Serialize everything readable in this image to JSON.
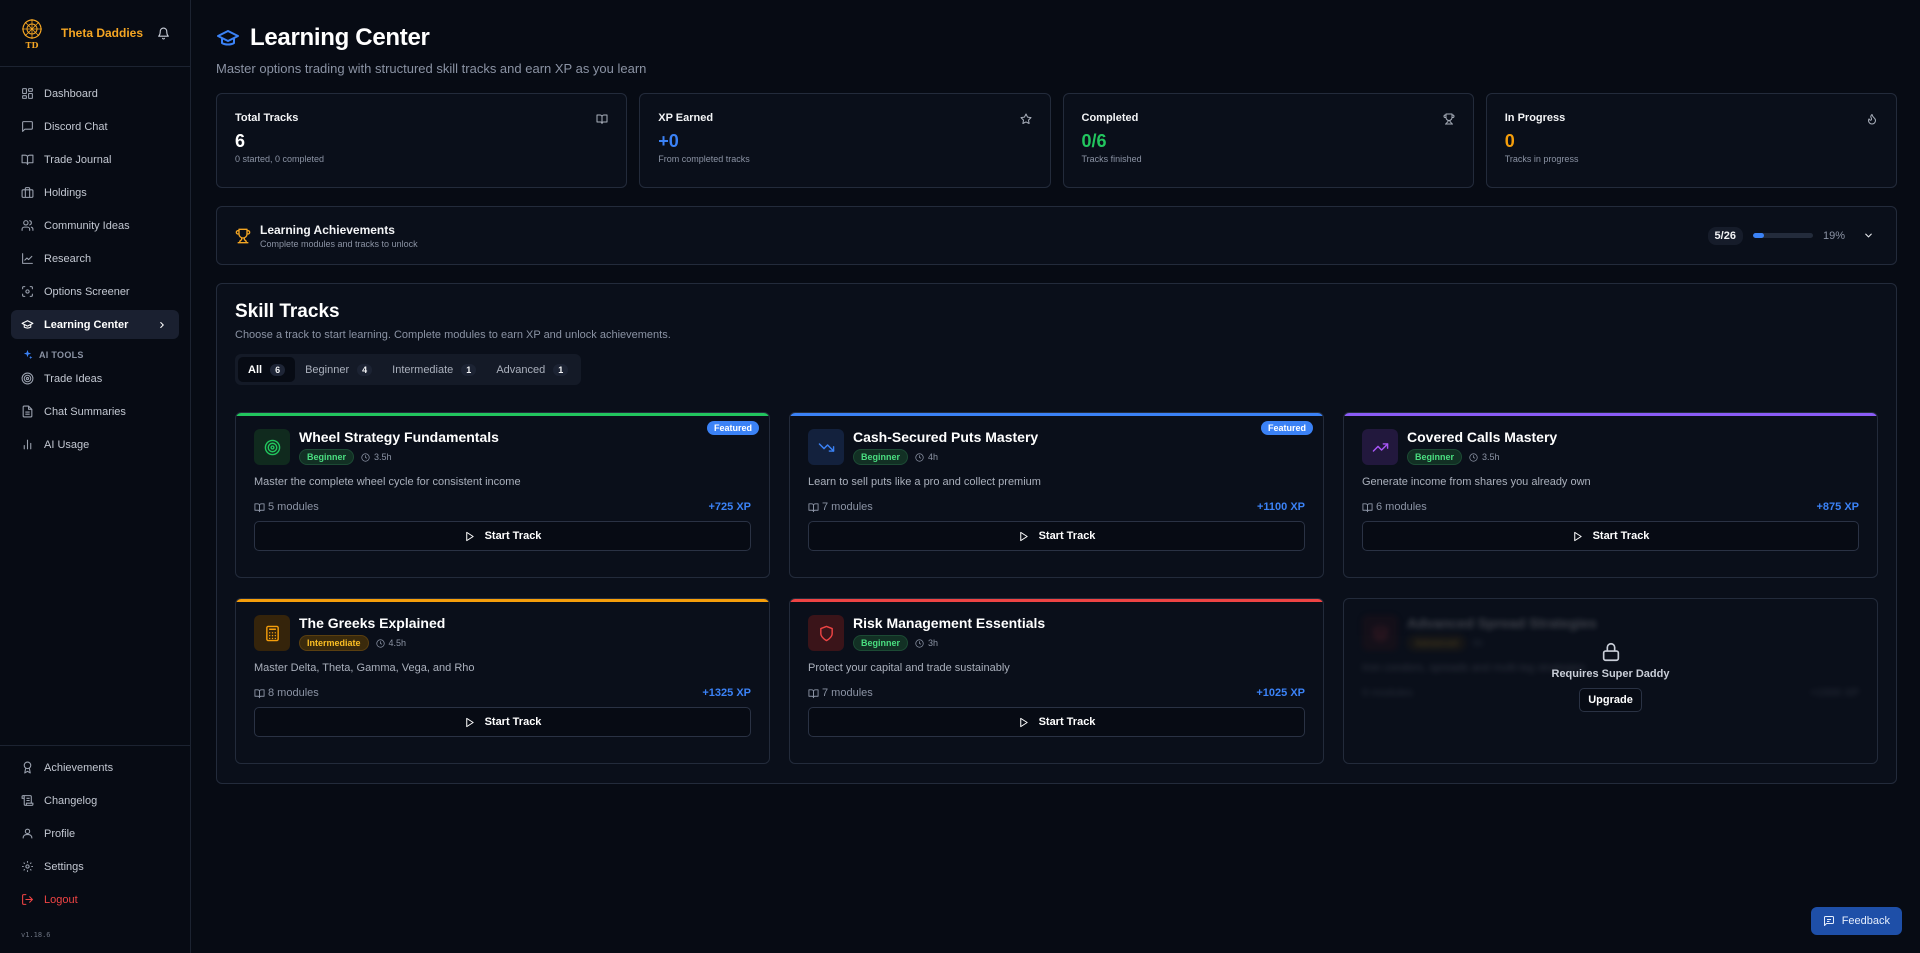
{
  "brand": {
    "name": "Theta Daddies",
    "logo_text": "TD"
  },
  "nav": {
    "items": [
      {
        "label": "Dashboard",
        "icon": "dashboard-icon"
      },
      {
        "label": "Discord Chat",
        "icon": "chat-icon"
      },
      {
        "label": "Trade Journal",
        "icon": "book-icon"
      },
      {
        "label": "Holdings",
        "icon": "briefcase-icon"
      },
      {
        "label": "Community Ideas",
        "icon": "users-icon"
      },
      {
        "label": "Research",
        "icon": "chart-line-icon"
      },
      {
        "label": "Options Screener",
        "icon": "scan-icon"
      },
      {
        "label": "Learning Center",
        "icon": "graduation-cap-icon",
        "active": true
      }
    ],
    "ai_tools_label": "AI TOOLS",
    "ai_items": [
      {
        "label": "Trade Ideas",
        "icon": "target-icon"
      },
      {
        "label": "Chat Summaries",
        "icon": "document-icon"
      },
      {
        "label": "AI Usage",
        "icon": "bar-chart-icon"
      }
    ],
    "bottom_items": [
      {
        "label": "Achievements",
        "icon": "award-icon"
      },
      {
        "label": "Changelog",
        "icon": "scroll-icon"
      },
      {
        "label": "Profile",
        "icon": "user-icon"
      },
      {
        "label": "Settings",
        "icon": "gear-icon"
      },
      {
        "label": "Logout",
        "icon": "logout-icon"
      }
    ],
    "version": "v1.18.6"
  },
  "header": {
    "title": "Learning Center",
    "subtitle": "Master options trading with structured skill tracks and earn XP as you learn"
  },
  "stats": [
    {
      "label": "Total Tracks",
      "value": "6",
      "sub": "0 started, 0 completed",
      "icon": "book-open-icon",
      "color": "#ffffff"
    },
    {
      "label": "XP Earned",
      "value": "+0",
      "sub": "From completed tracks",
      "icon": "star-icon",
      "color": "#3b82f6"
    },
    {
      "label": "Completed",
      "value": "0/6",
      "sub": "Tracks finished",
      "icon": "trophy-icon",
      "color": "#22c55e"
    },
    {
      "label": "In Progress",
      "value": "0",
      "sub": "Tracks in progress",
      "icon": "flame-icon",
      "color": "#f59e0b"
    }
  ],
  "achievements": {
    "title": "Learning Achievements",
    "desc": "Complete modules and tracks to unlock",
    "count": "5/26",
    "percent_label": "19%",
    "progress": 0.19
  },
  "skill_tracks": {
    "title": "Skill Tracks",
    "desc": "Choose a track to start learning. Complete modules to earn XP and unlock achievements.",
    "filters": [
      {
        "label": "All",
        "count": "6",
        "active": true
      },
      {
        "label": "Beginner",
        "count": "4"
      },
      {
        "label": "Intermediate",
        "count": "1"
      },
      {
        "label": "Advanced",
        "count": "1"
      }
    ],
    "start_label": "Start Track",
    "cards": [
      {
        "name": "Wheel Strategy Fundamentals",
        "level": "Beginner",
        "duration": "3.5h",
        "summary": "Master the complete wheel cycle for consistent income",
        "modules": "5 modules",
        "xp": "+725 XP",
        "featured": "Featured",
        "accent": "#22c55e",
        "icon": "target-icon"
      },
      {
        "name": "Cash-Secured Puts Mastery",
        "level": "Beginner",
        "duration": "4h",
        "summary": "Learn to sell puts like a pro and collect premium",
        "modules": "7 modules",
        "xp": "+1100 XP",
        "featured": "Featured",
        "accent": "#3b82f6",
        "icon": "trending-down-icon"
      },
      {
        "name": "Covered Calls Mastery",
        "level": "Beginner",
        "duration": "3.5h",
        "summary": "Generate income from shares you already own",
        "modules": "6 modules",
        "xp": "+875 XP",
        "accent": "#8b5cf6",
        "icon": "trending-up-icon"
      },
      {
        "name": "The Greeks Explained",
        "level": "Intermediate",
        "duration": "4.5h",
        "summary": "Master Delta, Theta, Gamma, Vega, and Rho",
        "modules": "8 modules",
        "xp": "+1325 XP",
        "accent": "#f59e0b",
        "icon": "calculator-icon"
      },
      {
        "name": "Risk Management Essentials",
        "level": "Beginner",
        "duration": "3h",
        "summary": "Protect your capital and trade sustainably",
        "modules": "7 modules",
        "xp": "+1025 XP",
        "accent": "#ef4444",
        "icon": "shield-icon"
      },
      {
        "name": "Advanced Spread Strategies",
        "level": "Advanced",
        "duration": "5h",
        "summary": "Iron condors, spreads and multi-leg strategies",
        "modules": "9 modules",
        "xp": "+1500 XP",
        "accent": "#ef4444",
        "icon": "layers-icon",
        "locked": true
      }
    ],
    "locked_message": "Requires Super Daddy",
    "upgrade_label": "Upgrade"
  },
  "feedback_label": "Feedback"
}
